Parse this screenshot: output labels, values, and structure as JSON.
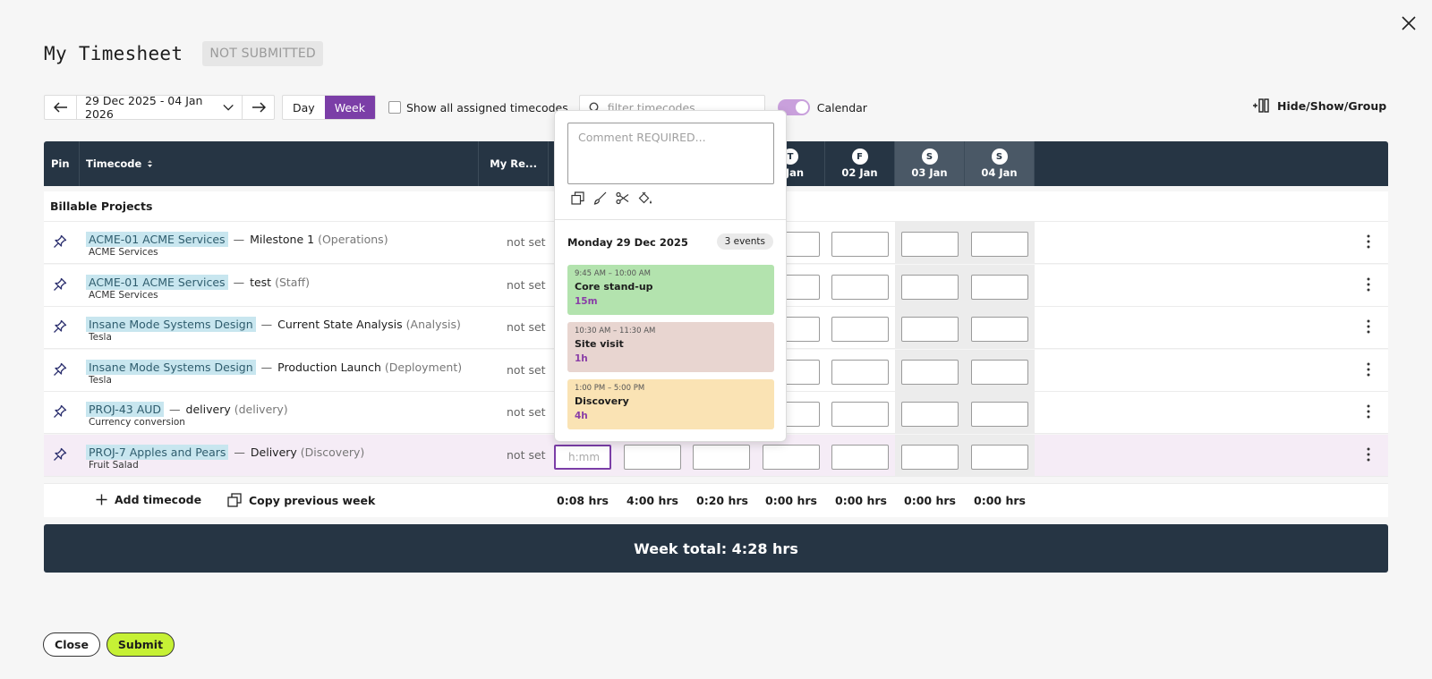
{
  "header": {
    "title": "My Timesheet",
    "status": "NOT SUBMITTED"
  },
  "toolbar": {
    "date_range": "29 Dec 2025 - 04 Jan 2026",
    "day_label": "Day",
    "week_label": "Week",
    "active_view": "Week",
    "show_all_label": "Show all assigned timecodes",
    "filter_placeholder": "filter timecodes",
    "calendar_label": "Calendar",
    "calendar_on": true,
    "hide_show_group_label": "Hide/Show/Group"
  },
  "columns": {
    "pin": "Pin",
    "timecode": "Timecode",
    "my_reports": "My Re...",
    "days": [
      {
        "letter": "T",
        "date": "Jan",
        "weekend": false
      },
      {
        "letter": "F",
        "date": "02 Jan",
        "weekend": false
      },
      {
        "letter": "S",
        "date": "03 Jan",
        "weekend": true
      },
      {
        "letter": "S",
        "date": "04 Jan",
        "weekend": true
      }
    ]
  },
  "section": {
    "label": "Billable Projects"
  },
  "rows": [
    {
      "code": "ACME-01  ACME Services",
      "name": "Milestone 1",
      "type": "(Operations)",
      "client": "ACME Services",
      "status": "not set"
    },
    {
      "code": "ACME-01  ACME Services",
      "name": "test",
      "type": "(Staff)",
      "client": "ACME Services",
      "status": "not set"
    },
    {
      "code": "Insane Mode Systems Design",
      "name": "Current State Analysis",
      "type": "(Analysis)",
      "client": "Tesla",
      "status": "not set"
    },
    {
      "code": "Insane Mode Systems Design",
      "name": "Production Launch",
      "type": "(Deployment)",
      "client": "Tesla",
      "status": "not set"
    },
    {
      "code": "PROJ-43  AUD",
      "name": "delivery",
      "type": "(delivery)",
      "client": "Currency conversion",
      "status": "not set"
    },
    {
      "code": "PROJ-7  Apples and Pears",
      "name": "Delivery",
      "type": "(Discovery)",
      "client": "Fruit Salad",
      "status": "not set",
      "input_placeholder": "h:mm"
    }
  ],
  "separator": "—",
  "footer": {
    "add_timecode": "Add timecode",
    "copy_previous_week": "Copy previous week",
    "totals": [
      "0:08 hrs",
      "4:00 hrs",
      "0:20 hrs",
      "0:00 hrs",
      "0:00 hrs",
      "0:00 hrs",
      "0:00 hrs"
    ]
  },
  "week_total": "Week total: 4:28 hrs",
  "buttons": {
    "close": "Close",
    "submit": "Submit"
  },
  "popup": {
    "comment_placeholder": "Comment REQUIRED...",
    "day_label": "Monday 29 Dec 2025",
    "events_count": "3 events",
    "events": [
      {
        "time": "9:45 AM – 10:00 AM",
        "title": "Core stand-up",
        "duration": "15m",
        "color": "#b3e3ae"
      },
      {
        "time": "10:30 AM – 11:30 AM",
        "title": "Site visit",
        "duration": "1h",
        "color": "#e8d5d0"
      },
      {
        "time": "1:00 PM – 5:00 PM",
        "title": "Discovery",
        "duration": "4h",
        "color": "#fae3b4"
      }
    ]
  },
  "colors": {
    "header_bg": "#263544",
    "accent": "#7b3ea7",
    "submit": "#c6f135"
  }
}
